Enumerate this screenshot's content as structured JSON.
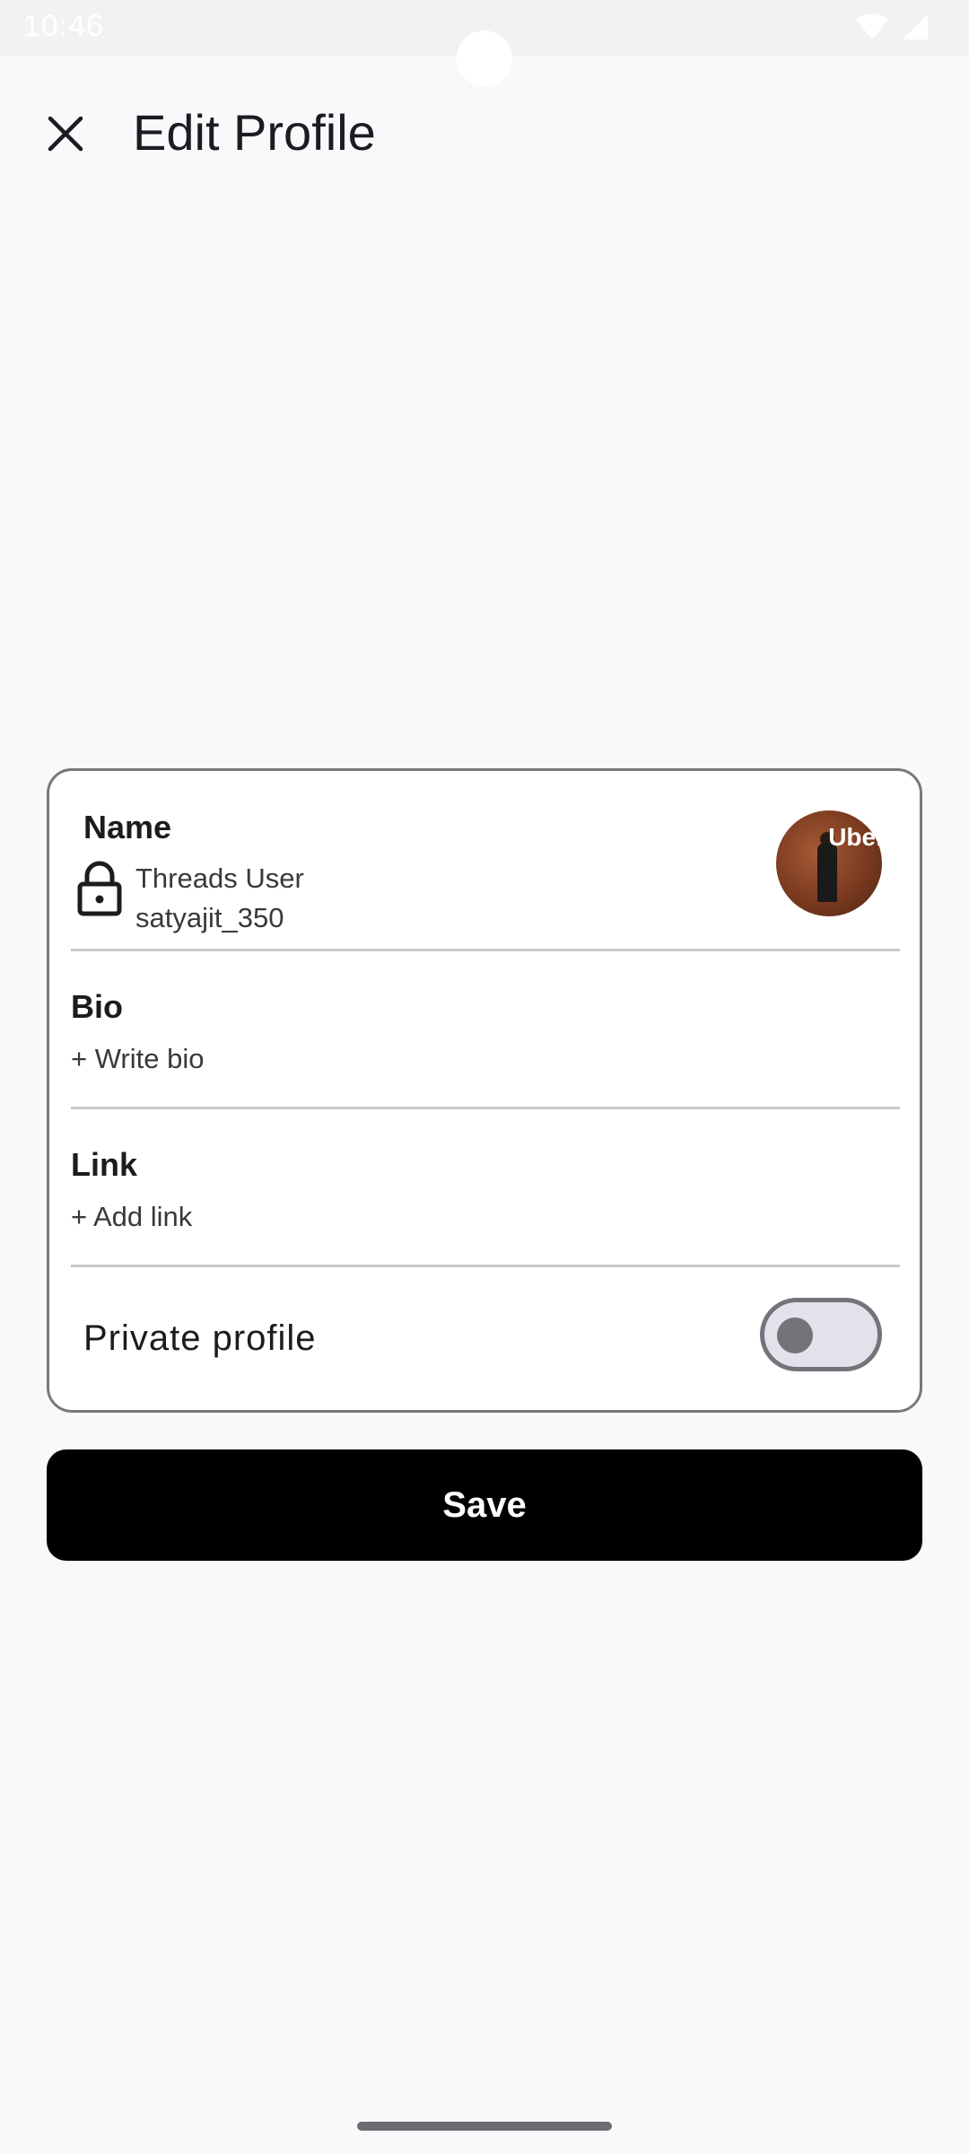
{
  "status_bar": {
    "time": "10:46",
    "icons": [
      "wifi-icon",
      "cellular-icon"
    ]
  },
  "header": {
    "close_icon": "close-icon",
    "title": "Edit Profile"
  },
  "profile_card": {
    "name": {
      "label": "Name",
      "display_name": "Threads User",
      "username": "satyajit_350",
      "lock_icon": "lock-icon"
    },
    "avatar": {
      "overlay_text": "Uber"
    },
    "bio": {
      "label": "Bio",
      "placeholder": "+ Write bio"
    },
    "link": {
      "label": "Link",
      "placeholder": "+ Add link"
    },
    "private_profile": {
      "label": "Private profile",
      "enabled": false
    }
  },
  "actions": {
    "save_label": "Save"
  },
  "colors": {
    "background": "#fbf8fc",
    "card_border": "#7a777c",
    "divider": "#c9c6cc",
    "button": "#000000",
    "toggle_track": "#e4e1ea",
    "toggle_outline": "#75727a"
  }
}
